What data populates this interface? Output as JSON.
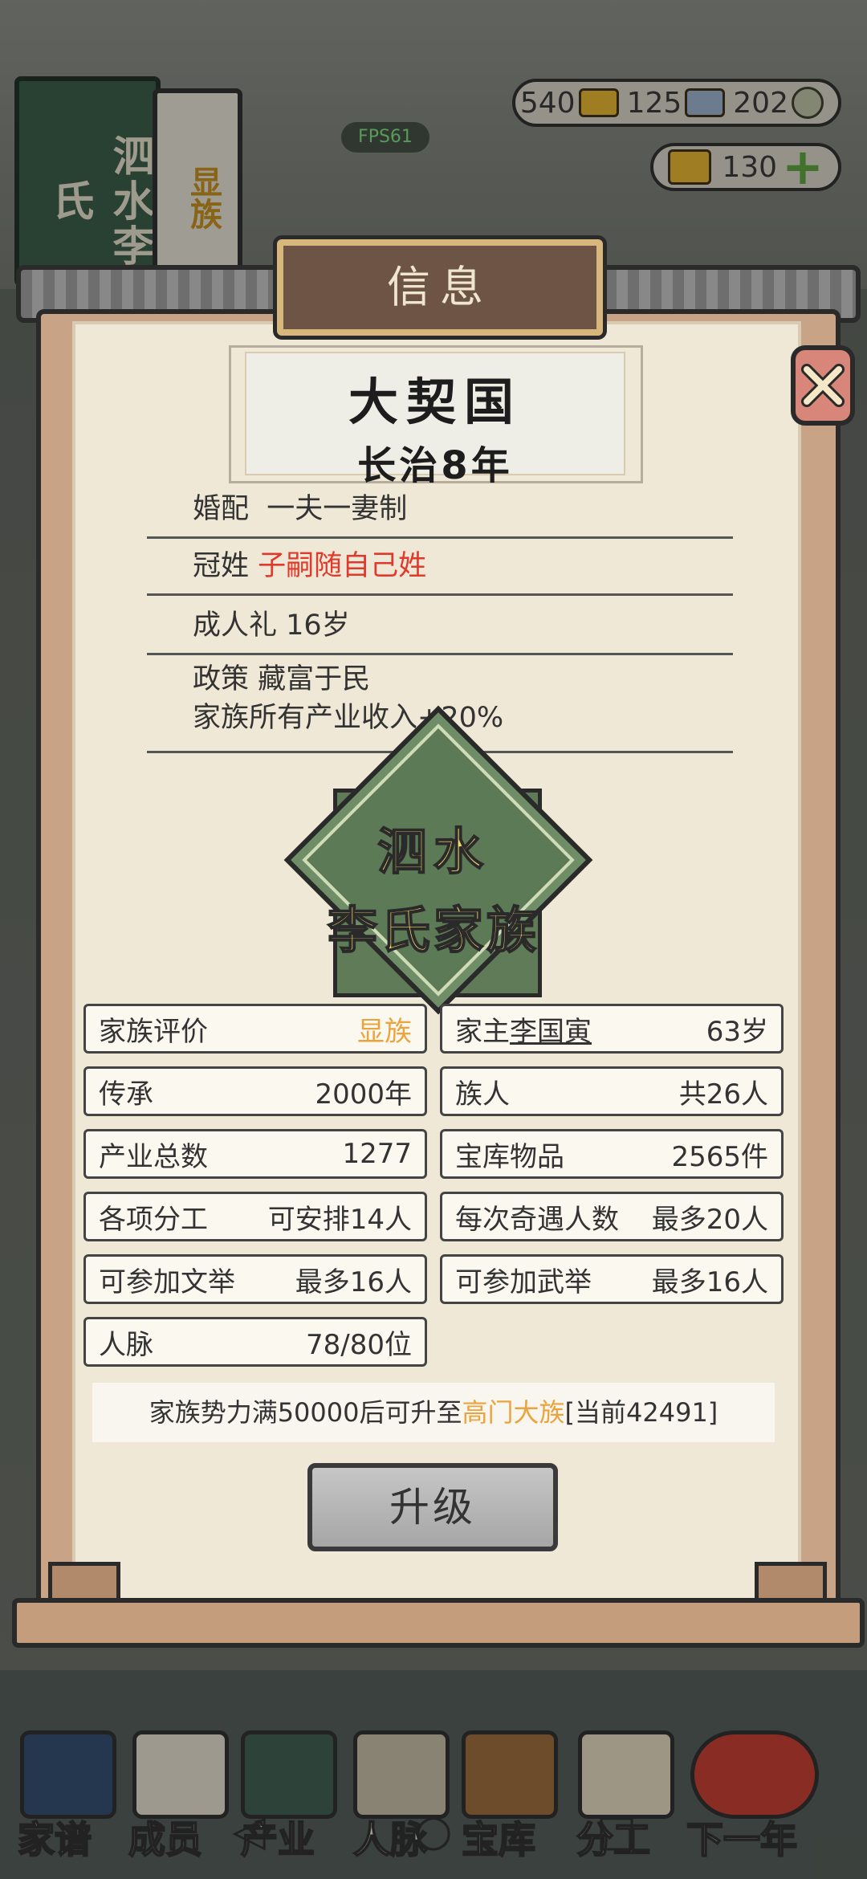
{
  "header": {
    "book_title": "泗水李氏",
    "book_badge": "显族",
    "fps": "FPS61",
    "gold_count": "540",
    "silver_count": "125",
    "coin_count": "202",
    "yuanbao_count": "130"
  },
  "modal": {
    "title": "信息",
    "era_name": "大契国",
    "era_year": "长治8年",
    "rows": [
      {
        "label": "婚配",
        "value": "一夫一妻制"
      },
      {
        "label": "冠姓",
        "value": "子嗣随自己姓"
      },
      {
        "label": "成人礼",
        "value": "16岁"
      },
      {
        "label": "政策",
        "value": "藏富于民",
        "line2": "家族所有产业收入+20%"
      }
    ],
    "emblem_line1": "泗水",
    "emblem_line2": "李氏家族",
    "stats": {
      "eval_label": "家族评价",
      "eval_value": "显族",
      "head_label": "家主",
      "head_name": "李国寅",
      "head_age": "63岁",
      "inherit_label": "传承",
      "inherit_value": "2000年",
      "members_label": "族人",
      "members_value": "共26人",
      "industry_label": "产业总数",
      "industry_value": "1277",
      "treasury_label": "宝库物品",
      "treasury_value": "2565件",
      "labor_label": "各项分工",
      "labor_value": "可安排14人",
      "encounter_label": "每次奇遇人数",
      "encounter_value": "最多20人",
      "civil_label": "可参加文举",
      "civil_value": "最多16人",
      "military_label": "可参加武举",
      "military_value": "最多16人",
      "network_label": "人脉",
      "network_value": "78/80位"
    },
    "notice_prefix": "家族势力满50000后可升至",
    "notice_highlight": "高门大族",
    "notice_suffix": "[当前42491]",
    "upgrade_label": "升级"
  },
  "nav": {
    "items": [
      "家谱",
      "成员",
      "产业",
      "人脉",
      "宝库",
      "分工",
      "下一年"
    ]
  },
  "colors": {
    "accent_gold": "#eba33c",
    "accent_red": "#e03a2c",
    "panel_paper": "#efe8d6"
  }
}
